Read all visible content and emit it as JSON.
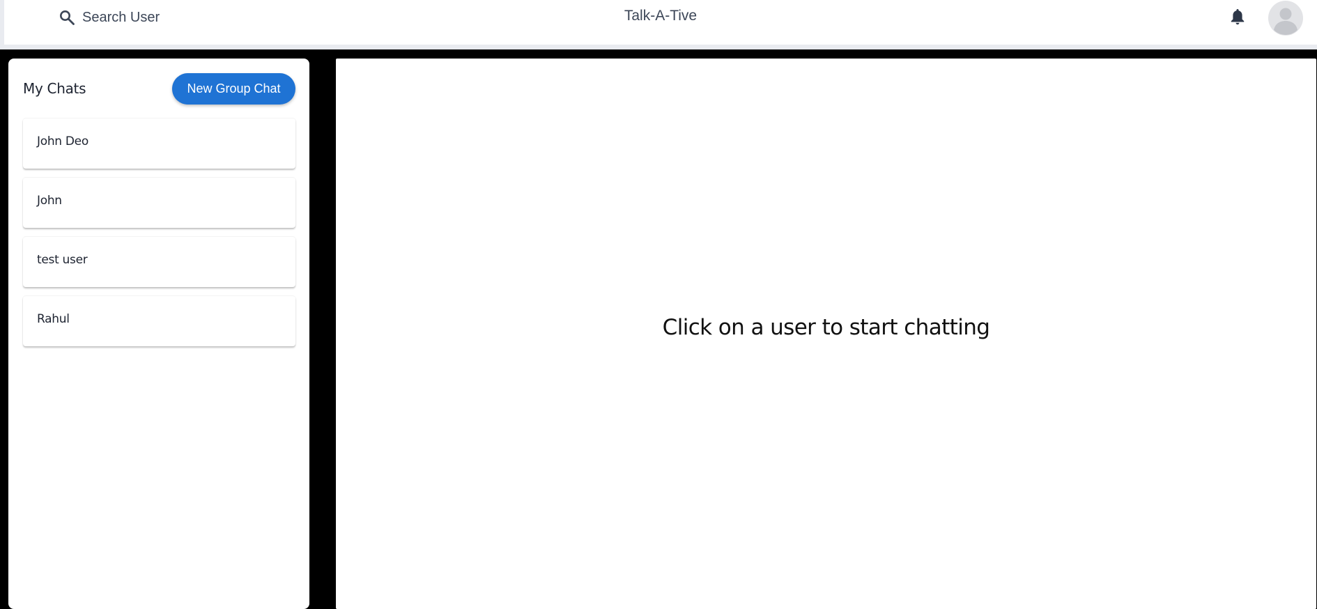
{
  "header": {
    "search_label": "Search User",
    "search_icon": "search-icon",
    "app_title": "Talk-A-Tive",
    "notification_icon": "bell-icon",
    "avatar_icon": "user-avatar-icon"
  },
  "sidebar": {
    "heading": "My Chats",
    "new_group_label": "New Group Chat",
    "chats": [
      {
        "name": "John Deo"
      },
      {
        "name": "John"
      },
      {
        "name": "test user"
      },
      {
        "name": "Rahul"
      }
    ]
  },
  "main": {
    "empty_message": "Click on a user to start chatting"
  },
  "colors": {
    "accent": "#1f73d4",
    "background": "#000000",
    "header_text": "#3c4657"
  }
}
